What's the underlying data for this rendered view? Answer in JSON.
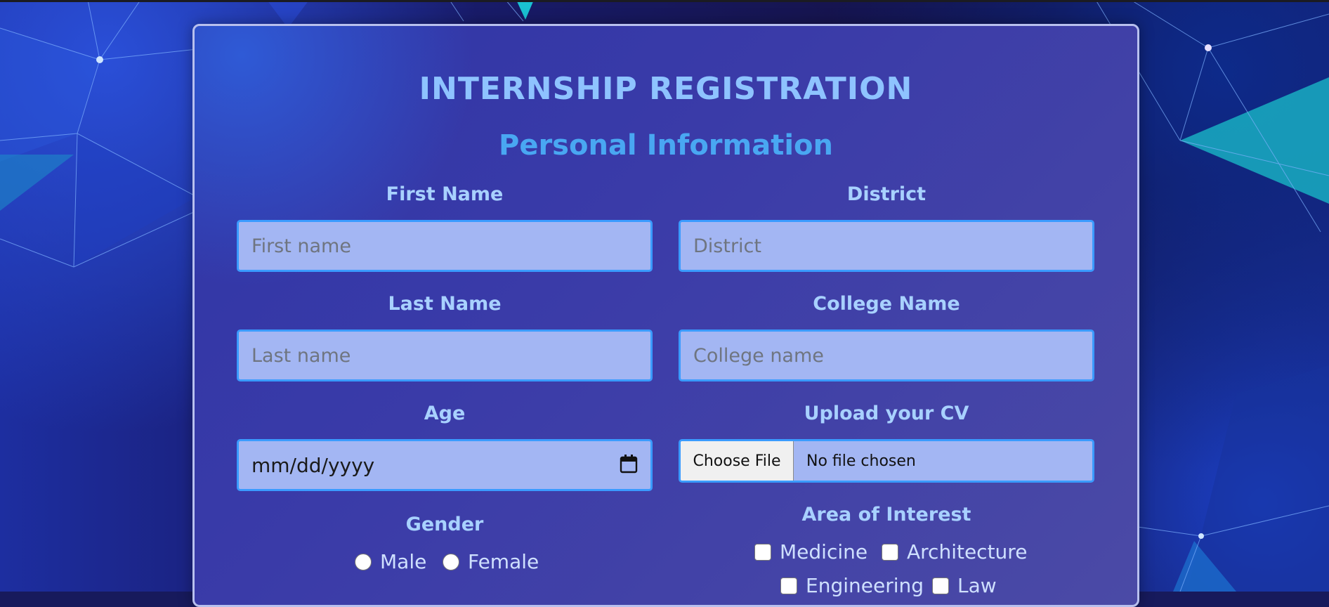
{
  "form": {
    "title": "INTERNSHIP REGISTRATION",
    "section_title": "Personal Information",
    "first_name": {
      "label": "First Name",
      "placeholder": "First name"
    },
    "last_name": {
      "label": "Last Name",
      "placeholder": "Last name"
    },
    "age": {
      "label": "Age",
      "placeholder": "mm/dd/yyyy"
    },
    "gender": {
      "label": "Gender",
      "options": [
        "Male",
        "Female"
      ]
    },
    "district": {
      "label": "District",
      "placeholder": "District"
    },
    "college_name": {
      "label": "College Name",
      "placeholder": "College name"
    },
    "cv": {
      "label": "Upload your CV",
      "button": "Choose File",
      "status": "No file chosen"
    },
    "interest": {
      "label": "Area of Interest",
      "options": [
        "Medicine",
        "Architecture",
        "Engineering",
        "Law"
      ]
    }
  },
  "colors": {
    "title": "#8ec3ff",
    "section_title": "#49a7f2",
    "label": "#a8d1ff",
    "field_bg": "#a3b6f3",
    "field_border": "#3a9bff",
    "card_border": "#b8c0ee"
  },
  "icons": {
    "calendar": "calendar-icon"
  }
}
